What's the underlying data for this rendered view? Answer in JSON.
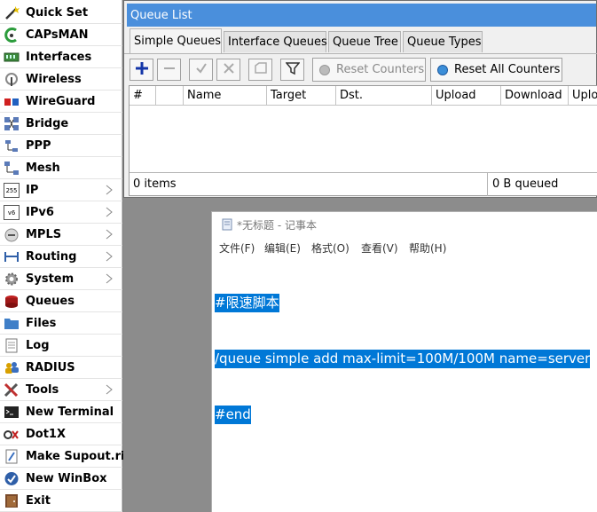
{
  "sidebar": {
    "items": [
      {
        "label": "Quick Set",
        "icon": "quick-set-wand-icon",
        "submenu": false
      },
      {
        "label": "CAPsMAN",
        "icon": "capsman-icon",
        "submenu": false
      },
      {
        "label": "Interfaces",
        "icon": "interfaces-icon",
        "submenu": false
      },
      {
        "label": "Wireless",
        "icon": "wireless-icon",
        "submenu": false
      },
      {
        "label": "WireGuard",
        "icon": "wireguard-icon",
        "submenu": false
      },
      {
        "label": "Bridge",
        "icon": "bridge-icon",
        "submenu": false
      },
      {
        "label": "PPP",
        "icon": "ppp-icon",
        "submenu": false
      },
      {
        "label": "Mesh",
        "icon": "mesh-icon",
        "submenu": false
      },
      {
        "label": "IP",
        "icon": "ip-icon",
        "icon_text": "255",
        "submenu": true
      },
      {
        "label": "IPv6",
        "icon": "ipv6-icon",
        "icon_text": "v6",
        "submenu": true
      },
      {
        "label": "MPLS",
        "icon": "mpls-icon",
        "submenu": true
      },
      {
        "label": "Routing",
        "icon": "routing-icon",
        "submenu": true
      },
      {
        "label": "System",
        "icon": "system-gear-icon",
        "submenu": true
      },
      {
        "label": "Queues",
        "icon": "queues-icon",
        "submenu": false
      },
      {
        "label": "Files",
        "icon": "files-folder-icon",
        "submenu": false
      },
      {
        "label": "Log",
        "icon": "log-icon",
        "submenu": false
      },
      {
        "label": "RADIUS",
        "icon": "radius-users-icon",
        "submenu": false
      },
      {
        "label": "Tools",
        "icon": "tools-icon",
        "submenu": true
      },
      {
        "label": "New Terminal",
        "icon": "terminal-icon",
        "submenu": false
      },
      {
        "label": "Dot1X",
        "icon": "dot1x-icon",
        "submenu": false
      },
      {
        "label": "Make Supout.rif",
        "icon": "supout-icon",
        "submenu": false
      },
      {
        "label": "New WinBox",
        "icon": "winbox-icon",
        "submenu": false
      },
      {
        "label": "Exit",
        "icon": "exit-icon",
        "submenu": false
      }
    ]
  },
  "queue_window": {
    "title": "Queue List",
    "tabs": [
      {
        "label": "Simple Queues",
        "active": true
      },
      {
        "label": "Interface Queues",
        "active": false
      },
      {
        "label": "Queue Tree",
        "active": false
      },
      {
        "label": "Queue Types",
        "active": false
      }
    ],
    "toolbar": {
      "reset_counters": "Reset Counters",
      "reset_all_counters": "Reset All Counters"
    },
    "columns": [
      "#",
      "",
      "Name",
      "Target",
      "Dst.",
      "Upload",
      "Download",
      "Uploa"
    ],
    "status_items": "0 items",
    "status_queued": "0 B queued"
  },
  "notepad": {
    "title": "*无标题 - 记事本",
    "menu": [
      "文件(F)",
      "编辑(E)",
      "格式(O)",
      "查看(V)",
      "帮助(H)"
    ],
    "lines": [
      "#限速脚本",
      "/queue simple add max-limit=100M/100M name=server",
      "#end"
    ]
  },
  "colors": {
    "title_bar": "#4a8fdc",
    "selection": "#0078d7",
    "desktop": "#8c8c8c"
  }
}
